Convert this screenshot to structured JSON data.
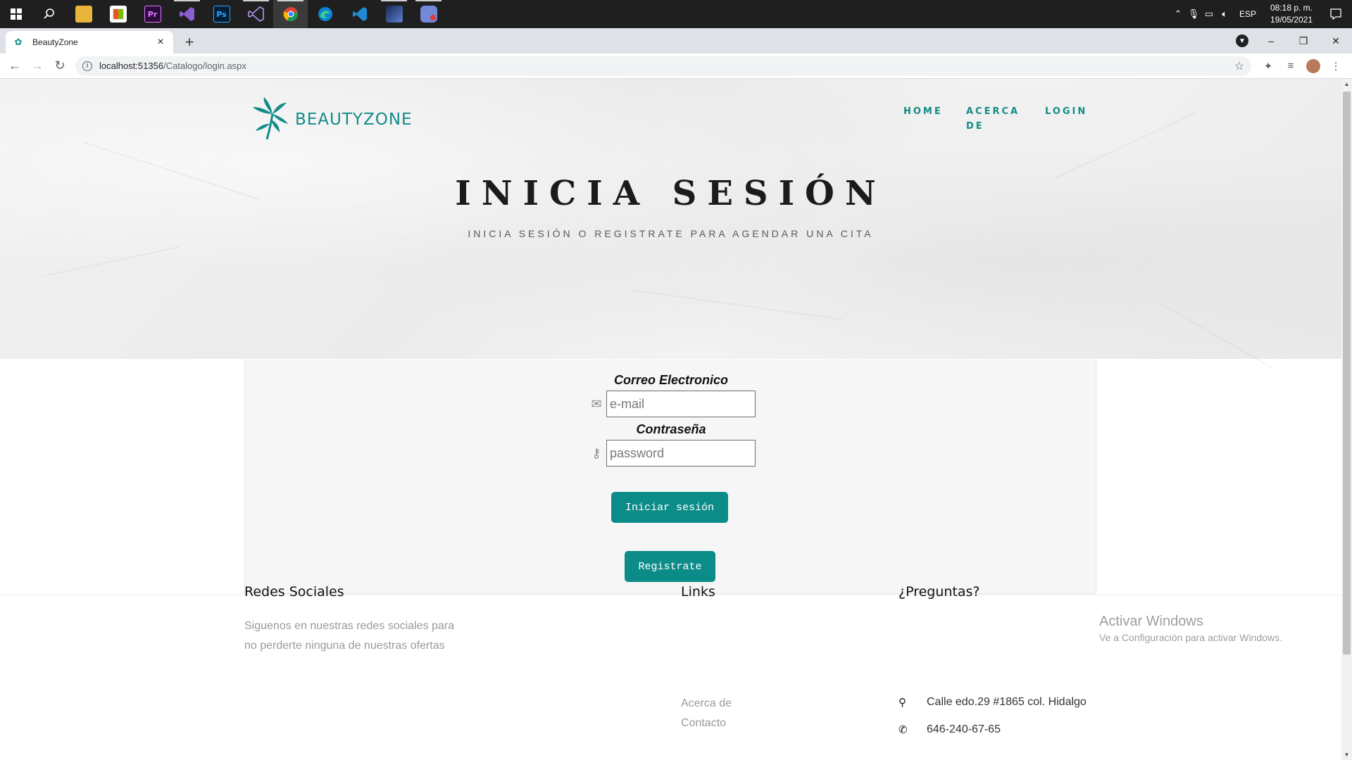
{
  "taskbar": {
    "apps": [
      {
        "name": "File Explorer",
        "icon": "folder-icon"
      },
      {
        "name": "Microsoft Store",
        "icon": "store-icon"
      },
      {
        "name": "Premiere Pro",
        "icon": "premiere-icon",
        "glyph": "Pr"
      },
      {
        "name": "Visual Studio",
        "icon": "visual-studio-icon"
      },
      {
        "name": "Photoshop",
        "icon": "photoshop-icon",
        "glyph": "Ps"
      },
      {
        "name": "Visual Studio",
        "icon": "visual-studio-icon"
      },
      {
        "name": "Chrome",
        "icon": "chrome-icon"
      },
      {
        "name": "Edge",
        "icon": "edge-icon"
      },
      {
        "name": "VS Code",
        "icon": "vscode-icon"
      },
      {
        "name": "Game",
        "icon": "game-icon"
      },
      {
        "name": "Discord",
        "icon": "discord-icon"
      }
    ],
    "language": "ESP",
    "time": "08:18 p. m.",
    "date": "19/05/2021"
  },
  "browser": {
    "tab_title": "BeautyZone",
    "url_host": "localhost:51356",
    "url_path": "/Catalogo/login.aspx"
  },
  "site": {
    "logo_text": "BEAUTYZONE",
    "nav": {
      "home": "HOME",
      "about": "ACERCA DE",
      "login": "LOGIN"
    },
    "hero_title": "INICIA SESIÓN",
    "hero_subtitle": "INICIA SESIÓN O REGISTRATE PARA AGENDAR UNA CITA"
  },
  "form": {
    "email_label": "Correo Electronico",
    "email_placeholder": "e-mail",
    "password_label": "Contraseña",
    "password_placeholder": "password",
    "login_button": "Iniciar sesión",
    "register_button": "Registrate"
  },
  "footer": {
    "social_title": "Redes Sociales",
    "social_text": "Siguenos en nuestras redes sociales para no perderte ninguna de nuestras ofertas",
    "links_title": "Links",
    "links": [
      "Acerca de",
      "Contacto"
    ],
    "questions_title": "¿Preguntas?",
    "address": "Calle edo.29 #1865 col. Hidalgo",
    "phone": "646-240-67-65"
  },
  "watermark": {
    "title": "Activar Windows",
    "subtitle": "Ve a Configuración para activar Windows."
  },
  "colors": {
    "accent": "#0c8c89",
    "taskbar": "#1f1f1f"
  }
}
